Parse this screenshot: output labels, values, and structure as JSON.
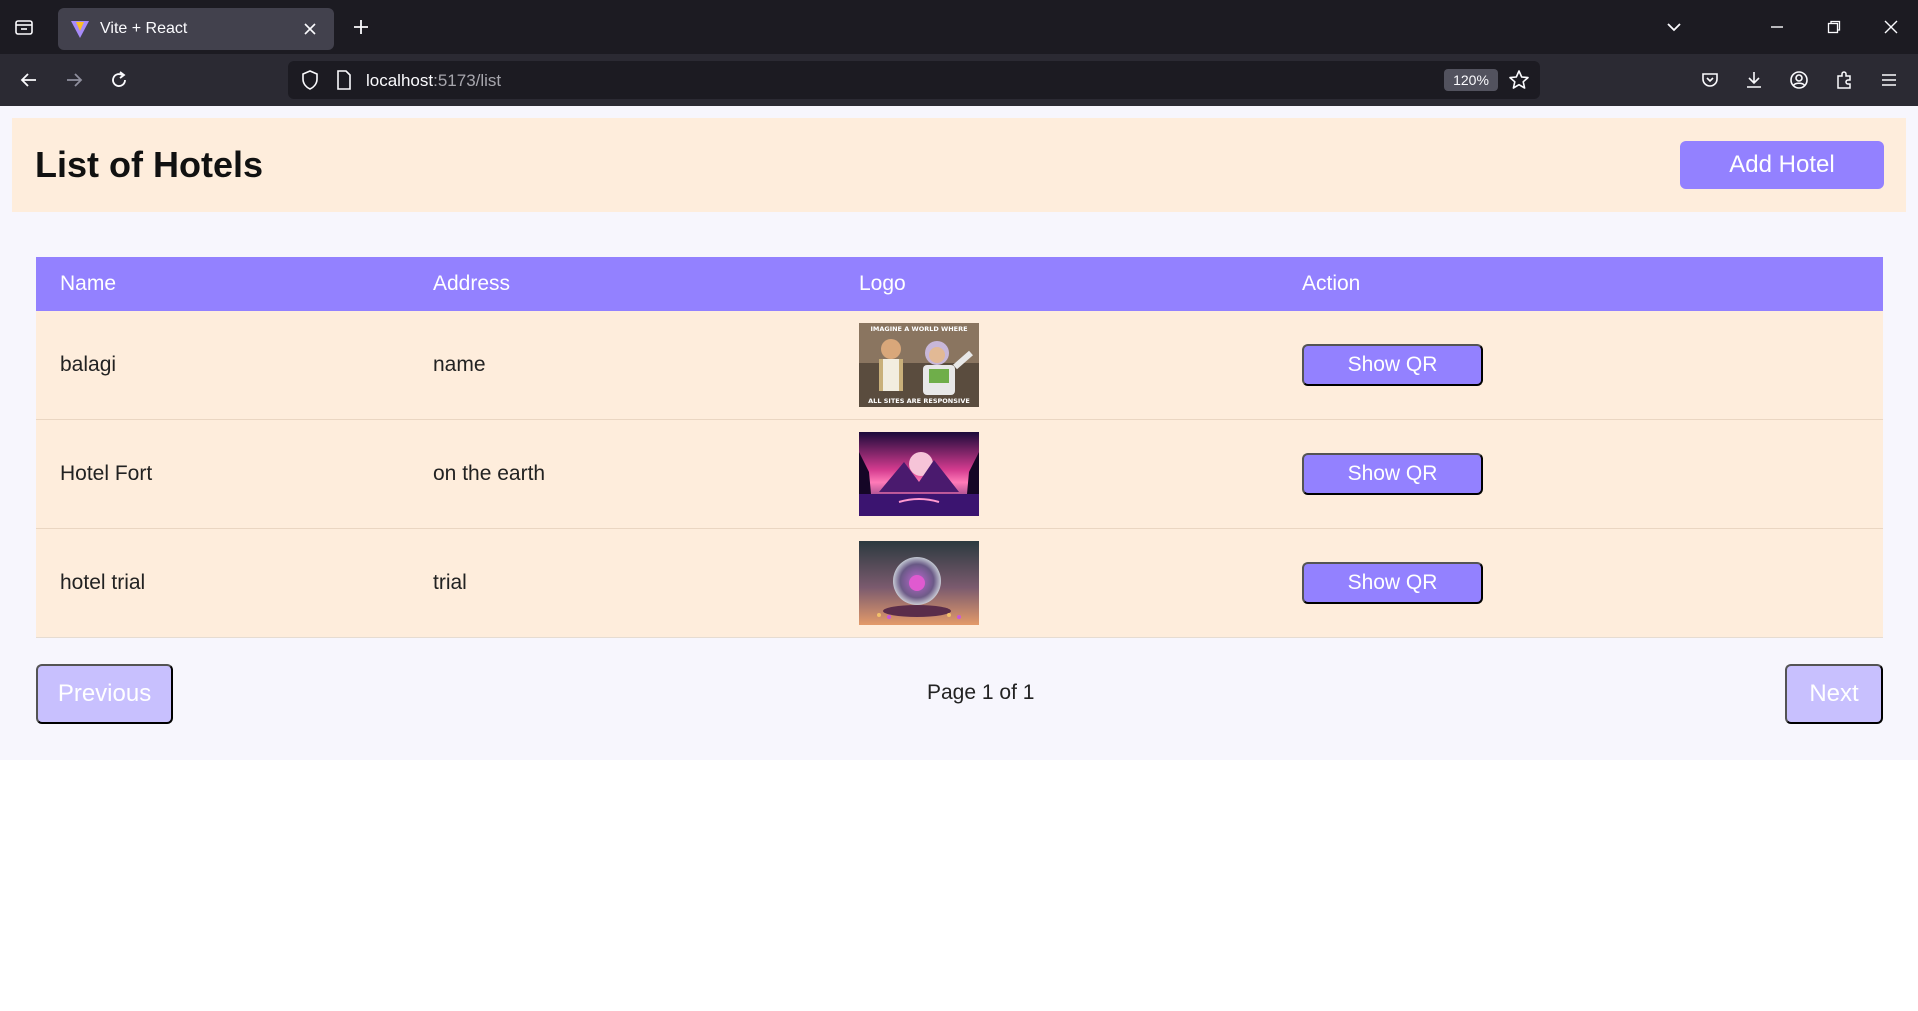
{
  "browser": {
    "tab_title": "Vite + React",
    "url_host": "localhost",
    "url_path": ":5173/list",
    "zoom": "120%"
  },
  "page": {
    "title": "List of Hotels",
    "add_button": "Add Hotel"
  },
  "table": {
    "headers": [
      "Name",
      "Address",
      "Logo",
      "Action"
    ],
    "rows": [
      {
        "name": "balagi",
        "address": "name",
        "logo_top": "IMAGINE A WORLD WHERE",
        "logo_bottom": "ALL SITES ARE RESPONSIVE",
        "action": "Show QR"
      },
      {
        "name": "Hotel Fort",
        "address": "on the earth",
        "action": "Show QR"
      },
      {
        "name": "hotel trial",
        "address": "trial",
        "action": "Show QR"
      }
    ]
  },
  "pagination": {
    "previous": "Previous",
    "info": "Page 1 of 1",
    "next": "Next"
  },
  "colors": {
    "accent": "#9381ff",
    "accent_disabled": "#c8c0fe",
    "row_bg": "#feeddc",
    "page_bg": "#f7f6fd"
  }
}
